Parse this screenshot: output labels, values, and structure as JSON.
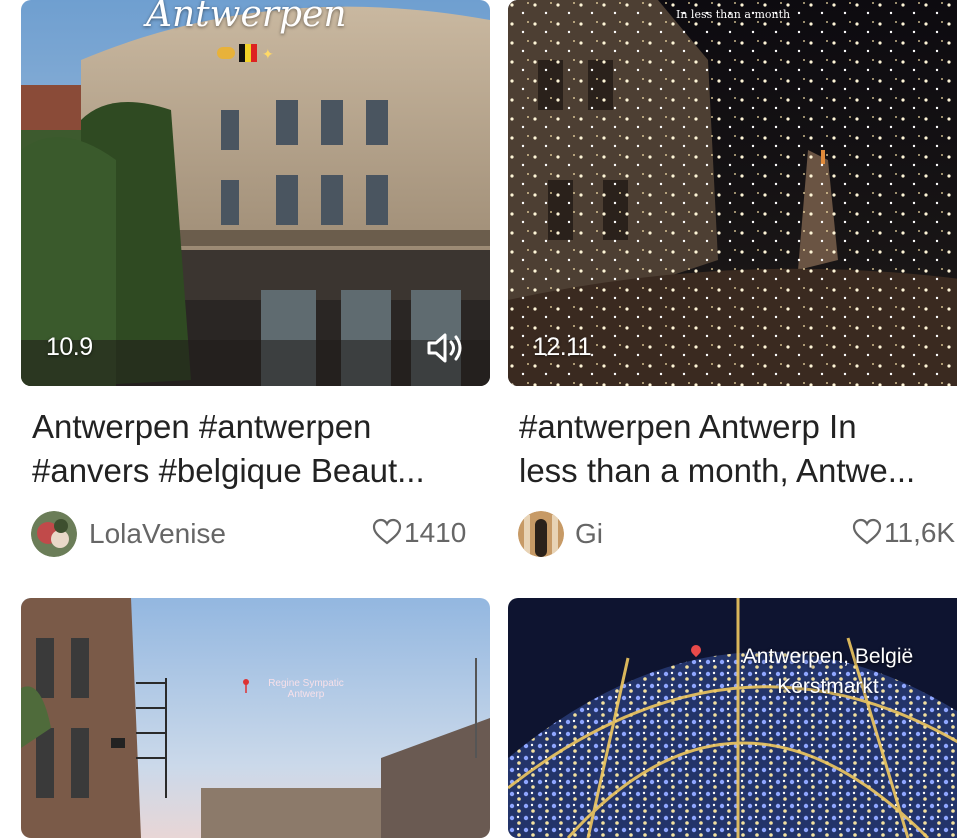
{
  "cards": [
    {
      "date": "10.9",
      "overlay": "Antwerpen",
      "title_line1": "Antwerpen #antwerpen",
      "title_line2": "#anvers #belgique Beaut...",
      "author": "LolaVenise",
      "likes": "1410",
      "sound_icon": "speaker-icon"
    },
    {
      "date": "12.11",
      "overlay": "In less than a month",
      "title_line1": "#antwerpen Antwerp In",
      "title_line2": "less than a month, Antwe...",
      "author": "Gi",
      "likes": "11,6K"
    },
    {
      "overlay_line1": "Regine Sympatic",
      "overlay_line2": "Antwerp"
    },
    {
      "overlay_line1": "Antwerpen, België",
      "overlay_line2": "Kerstmarkt"
    }
  ]
}
